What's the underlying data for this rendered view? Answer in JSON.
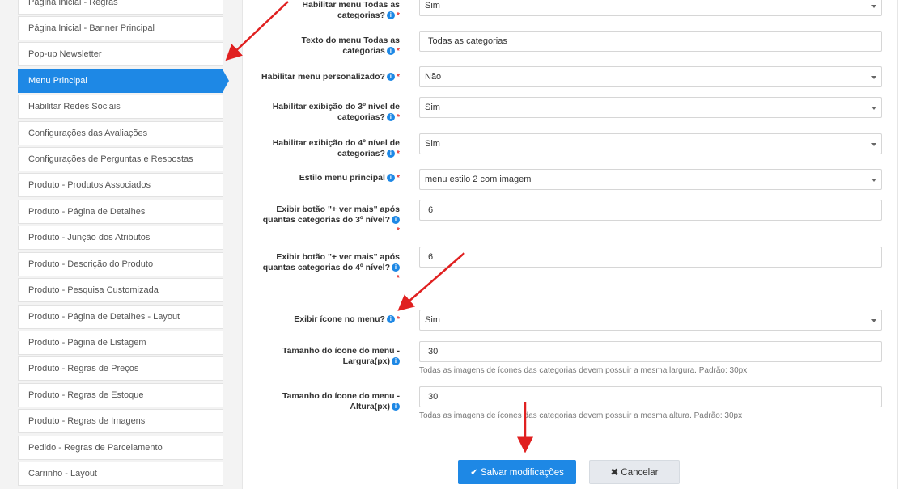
{
  "sidebar": {
    "items": [
      "Página Inicial - Regras",
      "Página Inicial - Banner Principal",
      "Pop-up Newsletter",
      "Menu Principal",
      "Habilitar Redes Sociais",
      "Configurações das Avaliações",
      "Configurações de Perguntas e Respostas",
      "Produto - Produtos Associados",
      "Produto - Página de Detalhes",
      "Produto - Junção dos Atributos",
      "Produto - Descrição do Produto",
      "Produto - Pesquisa Customizada",
      "Produto - Página de Detalhes - Layout",
      "Produto - Página de Listagem",
      "Produto - Regras de Preços",
      "Produto - Regras de Estoque",
      "Produto - Regras de Imagens",
      "Pedido - Regras de Parcelamento",
      "Carrinho - Layout"
    ],
    "active_index": 3
  },
  "form": {
    "f1": {
      "label_1": "Habilitar menu Todas as",
      "label_2": "categorias?",
      "value": "Sim"
    },
    "f2": {
      "label_1": "Texto do menu Todas as",
      "label_2": "categorias",
      "value": "Todas as categorias"
    },
    "f3": {
      "label_1": "Habilitar menu personalizado?",
      "value": "Não"
    },
    "f4": {
      "label_1": "Habilitar exibição do 3º nível de",
      "label_2": "categorias?",
      "value": "Sim"
    },
    "f5": {
      "label_1": "Habilitar exibição do 4º nível de",
      "label_2": "categorias?",
      "value": "Sim"
    },
    "f6": {
      "label_1": "Estilo menu principal",
      "value": "menu estilo 2 com imagem"
    },
    "f7": {
      "label_1": "Exibir botão \"+ ver mais\" após",
      "label_2": "quantas categorias do 3º nível?",
      "value": "6"
    },
    "f8": {
      "label_1": "Exibir botão \"+ ver mais\" após",
      "label_2": "quantas categorias do 4º nível?",
      "value": "6"
    },
    "f9": {
      "label_1": "Exibir ícone no menu?",
      "value": "Sim"
    },
    "f10": {
      "label_1": "Tamanho do ícone do menu -",
      "label_2": "Largura(px)",
      "value": "30",
      "help": "Todas as imagens de ícones das categorias devem possuir a mesma largura. Padrão: 30px"
    },
    "f11": {
      "label_1": "Tamanho do ícone do menu -",
      "label_2": "Altura(px)",
      "value": "30",
      "help": "Todas as imagens de ícones das categorias devem possuir a mesma altura. Padrão: 30px"
    }
  },
  "symbols": {
    "info": "i",
    "required": "*"
  },
  "buttons": {
    "save": {
      "icon": "✔",
      "label": "Salvar modificações"
    },
    "cancel": {
      "icon": "✖",
      "label": "Cancelar"
    }
  },
  "colors": {
    "accent": "#1e88e5",
    "annotation_arrow": "#e02020",
    "required": "#e53935"
  }
}
